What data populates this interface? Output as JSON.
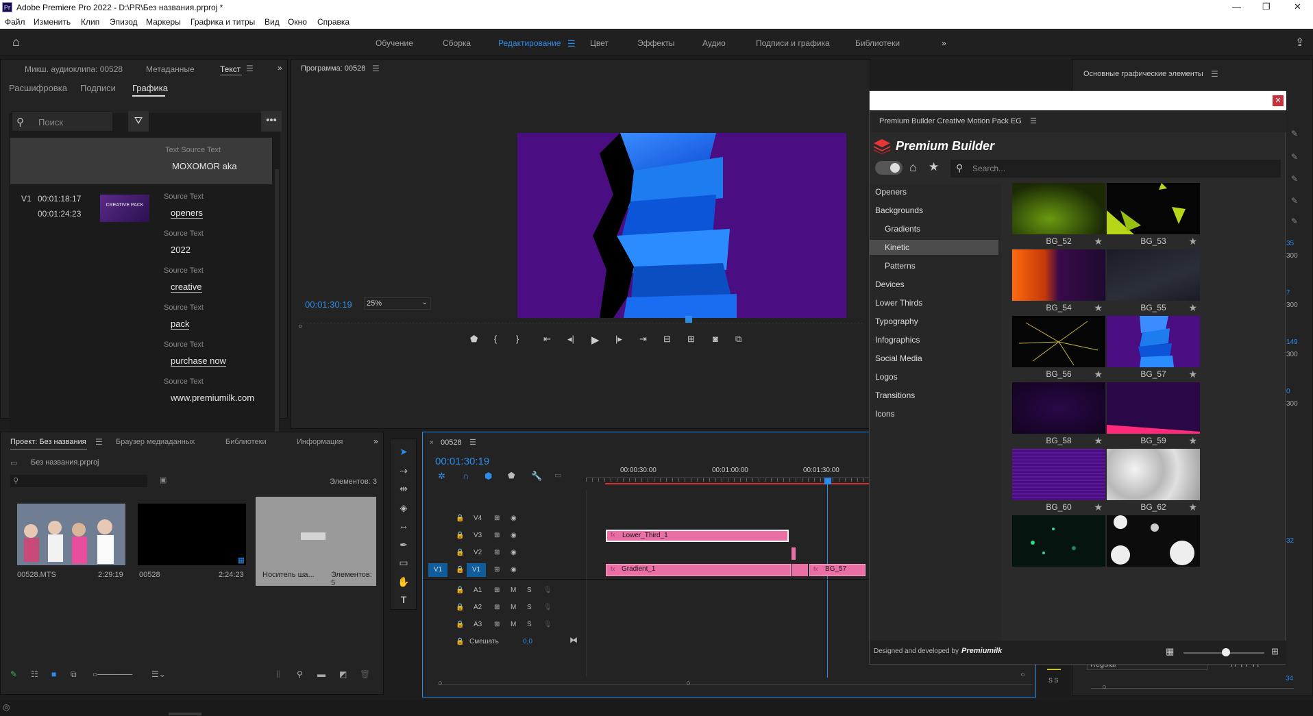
{
  "app": {
    "title": "Adobe Premiere Pro 2022 - D:\\PR\\Без названия.prproj *",
    "badge": "Pr"
  },
  "menu": [
    "Файл",
    "Изменить",
    "Клип",
    "Эпизод",
    "Маркеры",
    "Графика и титры",
    "Вид",
    "Окно",
    "Справка"
  ],
  "workspaces": [
    "Обучение",
    "Сборка",
    "Редактирование",
    "Цвет",
    "Эффекты",
    "Аудио",
    "Подписи и графика",
    "Библиотеки"
  ],
  "active_workspace": "Редактирование",
  "text_panel": {
    "tabs": [
      "Микш. аудиоклипа: 00528",
      "Метаданные",
      "Текст"
    ],
    "subtabs": [
      "Расшифровка",
      "Подписи",
      "Графика"
    ],
    "search_placeholder": "Поиск",
    "selected_item": {
      "label": "Text Source Text",
      "value": "MOXOMOR aka"
    },
    "track": "V1",
    "tc_in": "00:01:18:17",
    "tc_out": "00:01:24:23",
    "thumb_text": "CREATIVE PACK",
    "items": [
      {
        "label": "Source Text",
        "value": "openers"
      },
      {
        "label": "Source Text",
        "value": "2022"
      },
      {
        "label": "Source Text",
        "value": "creative"
      },
      {
        "label": "Source Text",
        "value": "pack"
      },
      {
        "label": "Source Text",
        "value": "purchase now"
      },
      {
        "label": "Source Text",
        "value": "www.premiumilk.com"
      }
    ]
  },
  "program": {
    "title": "Программа: 00528",
    "timecode": "00:01:30:19",
    "zoom": "25%"
  },
  "project": {
    "tabs": [
      "Проект: Без названия",
      "Браузер медиаданных",
      "Библиотеки",
      "Информация"
    ],
    "file": "Без названия.prproj",
    "count": "Элементов: 3",
    "items": [
      {
        "name": "00528.MTS",
        "duration": "2:29:19"
      },
      {
        "name": "00528",
        "duration": "2:24:23"
      },
      {
        "name": "Носитель ша...",
        "duration": "Элементов: 5"
      }
    ]
  },
  "timeline": {
    "seq": "00528",
    "timecode": "00:01:30:19",
    "ruler": [
      "00:00:30:00",
      "00:01:00:00",
      "00:01:30:00"
    ],
    "video_tracks": [
      "V4",
      "V3",
      "V2",
      "V1"
    ],
    "audio_tracks": [
      "A1",
      "A2",
      "A3"
    ],
    "mix_label": "Смешать",
    "mix_value": "0,0",
    "clips": {
      "lower_third": "Lower_Third_1",
      "gradient": "Gradient_1",
      "bg57": "BG_57"
    },
    "source_patch": "V1",
    "mute": "M",
    "solo": "S"
  },
  "essential": {
    "title": "Основные графические элементы",
    "font_style": "Regular",
    "size": "34"
  },
  "plugin": {
    "title": "Premium Builder Creative Motion Pack EG",
    "brand": "Premium Builder",
    "search_placeholder": "Search...",
    "categories": [
      {
        "label": "Openers",
        "sub": false,
        "sel": false
      },
      {
        "label": "Backgrounds",
        "sub": false,
        "sel": false
      },
      {
        "label": "Gradients",
        "sub": true,
        "sel": false
      },
      {
        "label": "Kinetic",
        "sub": true,
        "sel": true
      },
      {
        "label": "Patterns",
        "sub": true,
        "sel": false
      },
      {
        "label": "Devices",
        "sub": false,
        "sel": false
      },
      {
        "label": "Lower Thirds",
        "sub": false,
        "sel": false
      },
      {
        "label": "Typography",
        "sub": false,
        "sel": false
      },
      {
        "label": "Infographics",
        "sub": false,
        "sel": false
      },
      {
        "label": "Social Media",
        "sub": false,
        "sel": false
      },
      {
        "label": "Logos",
        "sub": false,
        "sel": false
      },
      {
        "label": "Transitions",
        "sub": false,
        "sel": false
      },
      {
        "label": "Icons",
        "sub": false,
        "sel": false
      }
    ],
    "thumbs": [
      "BG_52",
      "BG_53",
      "BG_54",
      "BG_55",
      "BG_56",
      "BG_57",
      "BG_58",
      "BG_59",
      "BG_60",
      "BG_62",
      "",
      ""
    ],
    "footer": "Designed and developed by",
    "footer_brand": "Premiumilk"
  },
  "right_nums": [
    "35",
    "300",
    "7",
    "300",
    "149",
    "300",
    "0",
    "300",
    "32"
  ]
}
